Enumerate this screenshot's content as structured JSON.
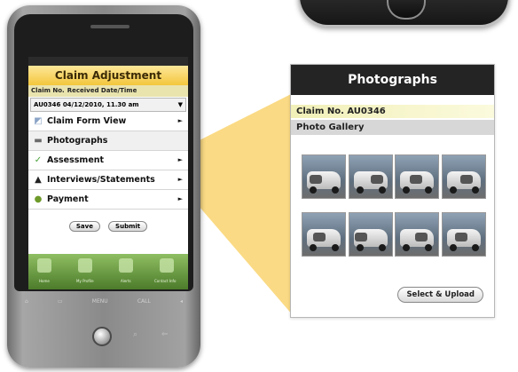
{
  "phone": {
    "title": "Claim Adjustment",
    "claim_no_header": "Claim No.",
    "received_header": "Received Date/Time",
    "selected_claim": "AU0346",
    "selected_date": "04/12/2010, 11.30 am",
    "menu": [
      {
        "label": "Claim Form View",
        "icon": "form-icon"
      },
      {
        "label": "Photographs",
        "icon": "photo-icon"
      },
      {
        "label": "Assessment",
        "icon": "check-icon"
      },
      {
        "label": "Interviews/Statements",
        "icon": "person-icon"
      },
      {
        "label": "Payment",
        "icon": "money-bag-icon"
      }
    ],
    "save_label": "Save",
    "submit_label": "Submit",
    "dock_labels": [
      "Home",
      "My Profile",
      "Alerts",
      "Contact Info"
    ],
    "keys": [
      "⌂",
      "▭",
      "MENU",
      "CALL",
      "◂"
    ]
  },
  "panel": {
    "title": "Photographs",
    "claim_label": "Claim No. AU0346",
    "gallery_label": "Photo Gallery",
    "upload_label": "Select & Upload"
  },
  "colors": {
    "accent": "#f3c63c",
    "highlight": "#f1f0b8",
    "beam": "#f9d36e"
  }
}
